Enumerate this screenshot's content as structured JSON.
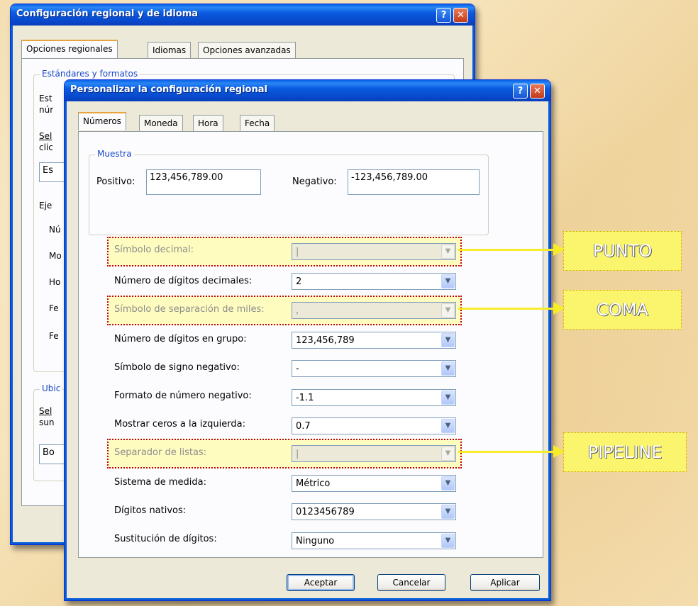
{
  "back_dialog": {
    "title": "Configuración regional y de idioma",
    "tabs": [
      "Opciones regionales",
      "Idiomas",
      "Opciones avanzadas"
    ],
    "group_standards": "Estándares y formatos",
    "fragments": {
      "f1": "Est",
      "f2": "núr",
      "f3": "Sel",
      "f4": "clic",
      "f5": "Es",
      "f6": "Eje",
      "f7": "Nú",
      "f8": "Mo",
      "f9": "Ho",
      "f10": "Fe",
      "f11": "Fe",
      "group_location": "Ubic",
      "f12": "Sel",
      "f13": "sun",
      "f14": "Bo"
    }
  },
  "front_dialog": {
    "title": "Personalizar la configuración regional",
    "tabs": [
      "Números",
      "Moneda",
      "Hora",
      "Fecha"
    ],
    "sample": {
      "legend": "Muestra",
      "positive_label": "Positivo:",
      "positive_value": "123,456,789.00",
      "negative_label": "Negativo:",
      "negative_value": "-123,456,789.00"
    },
    "rows": [
      {
        "label": "Símbolo decimal:",
        "value": "|",
        "highlight": true
      },
      {
        "label": "Número de dígitos decimales:",
        "value": "2"
      },
      {
        "label": "Símbolo de separación de miles:",
        "value": ",",
        "highlight": true
      },
      {
        "label": "Número de dígitos en grupo:",
        "value": "123,456,789"
      },
      {
        "label": "Símbolo de signo negativo:",
        "value": "-"
      },
      {
        "label": "Formato de número negativo:",
        "value": "-1.1"
      },
      {
        "label": "Mostrar ceros a la izquierda:",
        "value": "0.7"
      },
      {
        "label": "Separador de listas:",
        "value": "|",
        "highlight": true
      },
      {
        "label": "Sistema de medida:",
        "value": "Métrico"
      },
      {
        "label": "Dígitos nativos:",
        "value": "0123456789"
      },
      {
        "label": "Sustitución de dígitos:",
        "value": "Ninguno"
      }
    ],
    "buttons": {
      "ok": "Aceptar",
      "cancel": "Cancelar",
      "apply": "Aplicar"
    }
  },
  "callouts": {
    "punto": "PUNTO",
    "coma": "COMA",
    "pipeline": "PIPELINE"
  },
  "title_buttons": {
    "help": "?",
    "close": "✕"
  }
}
